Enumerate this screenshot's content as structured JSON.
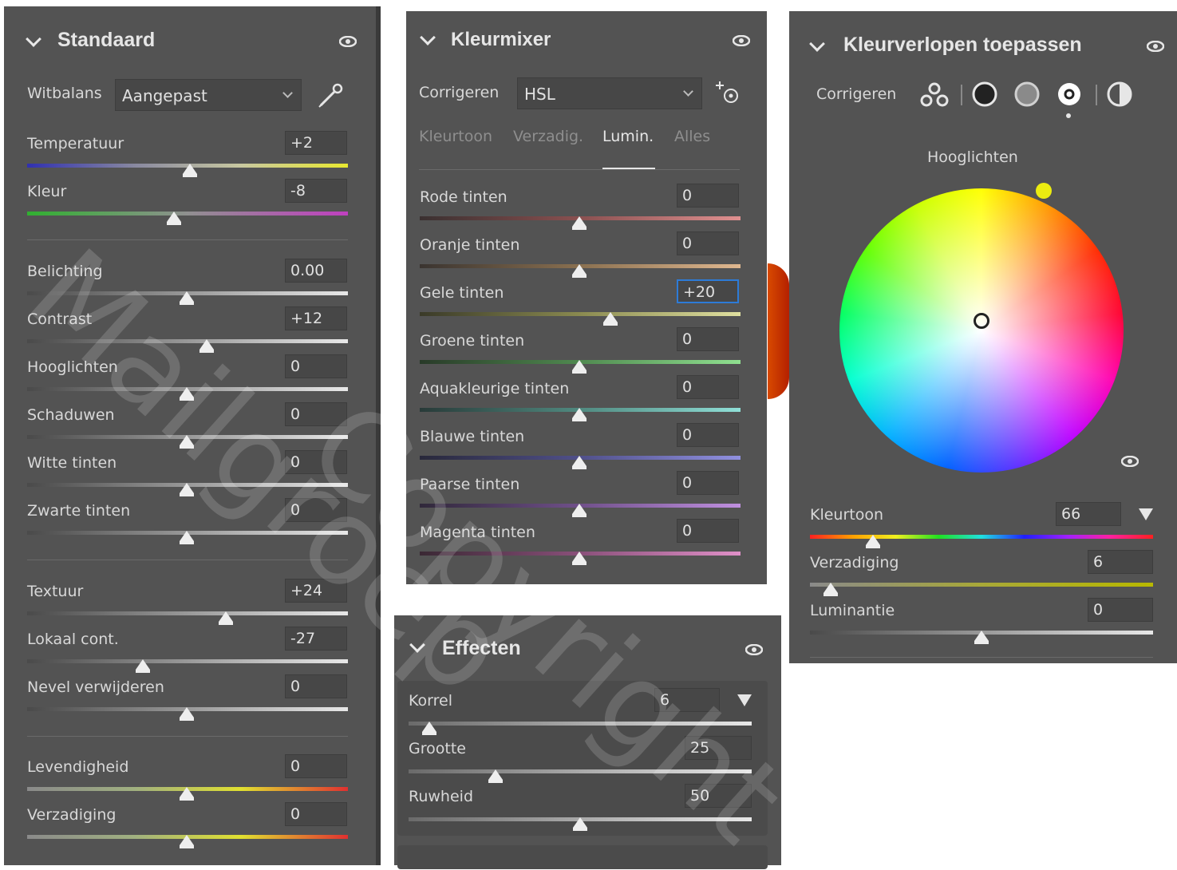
{
  "standaard": {
    "title": "Standaard",
    "witbalans_label": "Witbalans",
    "witbalans_value": "Aangepast",
    "sliders": [
      {
        "label": "Temperatuur",
        "value": "+2"
      },
      {
        "label": "Kleur",
        "value": "-8"
      },
      {
        "label": "Belichting",
        "value": "0.00"
      },
      {
        "label": "Contrast",
        "value": "+12"
      },
      {
        "label": "Hooglichten",
        "value": "0"
      },
      {
        "label": "Schaduwen",
        "value": "0"
      },
      {
        "label": "Witte tinten",
        "value": "0"
      },
      {
        "label": "Zwarte tinten",
        "value": "0"
      },
      {
        "label": "Textuur",
        "value": "+24"
      },
      {
        "label": "Lokaal cont.",
        "value": "-27"
      },
      {
        "label": "Nevel verwijderen",
        "value": "0"
      },
      {
        "label": "Levendigheid",
        "value": "0"
      },
      {
        "label": "Verzadiging",
        "value": "0"
      }
    ]
  },
  "kleurmixer": {
    "title": "Kleurmixer",
    "corrigeren_label": "Corrigeren",
    "corrigeren_value": "HSL",
    "tabs": [
      "Kleurtoon",
      "Verzadig.",
      "Lumin.",
      "Alles"
    ],
    "sliders": [
      {
        "label": "Rode tinten",
        "value": "0"
      },
      {
        "label": "Oranje tinten",
        "value": "0"
      },
      {
        "label": "Gele tinten",
        "value": "+20"
      },
      {
        "label": "Groene tinten",
        "value": "0"
      },
      {
        "label": "Aquakleurige tinten",
        "value": "0"
      },
      {
        "label": "Blauwe tinten",
        "value": "0"
      },
      {
        "label": "Paarse tinten",
        "value": "0"
      },
      {
        "label": "Magenta tinten",
        "value": "0"
      }
    ]
  },
  "effecten": {
    "title": "Effecten",
    "sliders": [
      {
        "label": "Korrel",
        "value": "6"
      },
      {
        "label": "Grootte",
        "value": "25"
      },
      {
        "label": "Ruwheid",
        "value": "50"
      }
    ]
  },
  "kleurverlopen": {
    "title": "Kleurverlopen toepassen",
    "corrigeren_label": "Corrigeren",
    "wheel_label": "Hooglichten",
    "sliders": [
      {
        "label": "Kleurtoon",
        "value": "66"
      },
      {
        "label": "Verzadiging",
        "value": "6"
      },
      {
        "label": "Luminantie",
        "value": "0"
      }
    ]
  },
  "watermark": {
    "line1": "Mailgroep",
    "line2": "Copyright"
  },
  "colors": {
    "panel_bg": "#535353",
    "field_bg": "#474747",
    "focus": "#2d7bd7"
  }
}
